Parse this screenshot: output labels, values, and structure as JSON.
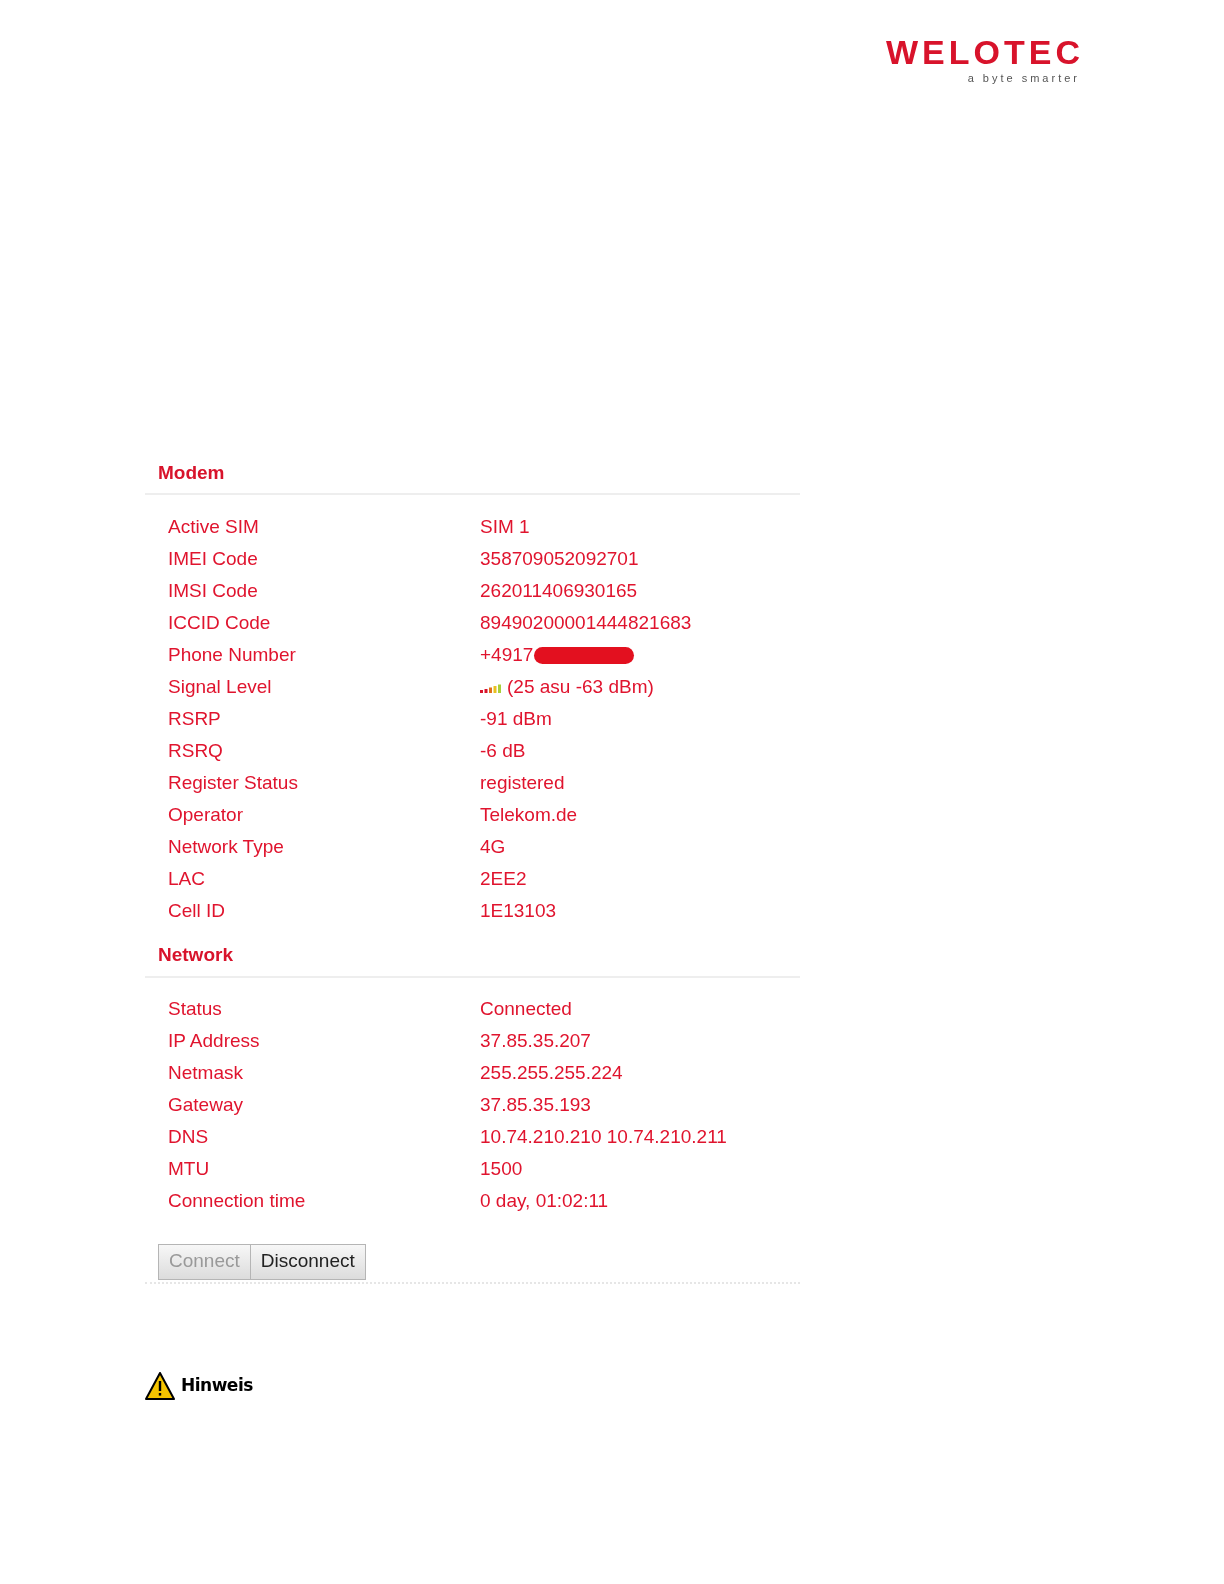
{
  "logo": {
    "name": "WELOTEC",
    "tagline": "a byte smarter"
  },
  "sections": [
    {
      "title": "Modem",
      "rows": [
        {
          "label": "Active SIM",
          "value": "SIM 1"
        },
        {
          "label": "IMEI Code",
          "value": "358709052092701"
        },
        {
          "label": "IMSI Code",
          "value": "262011406930165"
        },
        {
          "label": "ICCID Code",
          "value": "89490200001444821683"
        },
        {
          "label": "Phone Number",
          "value": "+4917",
          "kind": "redacted"
        },
        {
          "label": "Signal Level",
          "value": "(25 asu -63 dBm)",
          "kind": "signal"
        },
        {
          "label": "RSRP",
          "value": "-91 dBm"
        },
        {
          "label": "RSRQ",
          "value": "-6 dB"
        },
        {
          "label": "Register Status",
          "value": "registered"
        },
        {
          "label": "Operator",
          "value": "Telekom.de"
        },
        {
          "label": "Network Type",
          "value": "4G"
        },
        {
          "label": "LAC",
          "value": "2EE2"
        },
        {
          "label": "Cell ID",
          "value": "1E13103"
        }
      ]
    },
    {
      "title": "Network",
      "rows": [
        {
          "label": "Status",
          "value": "Connected"
        },
        {
          "label": "IP Address",
          "value": "37.85.35.207"
        },
        {
          "label": "Netmask",
          "value": "255.255.255.224"
        },
        {
          "label": "Gateway",
          "value": "37.85.35.193"
        },
        {
          "label": "DNS",
          "value": "10.74.210.210 10.74.210.211"
        },
        {
          "label": "MTU",
          "value": "1500"
        },
        {
          "label": "Connection time",
          "value": "0 day, 01:02:11"
        }
      ]
    }
  ],
  "buttons": [
    {
      "label": "Connect",
      "disabled": true
    },
    {
      "label": "Disconnect",
      "disabled": false
    }
  ],
  "note": {
    "title": "Hinweis"
  }
}
